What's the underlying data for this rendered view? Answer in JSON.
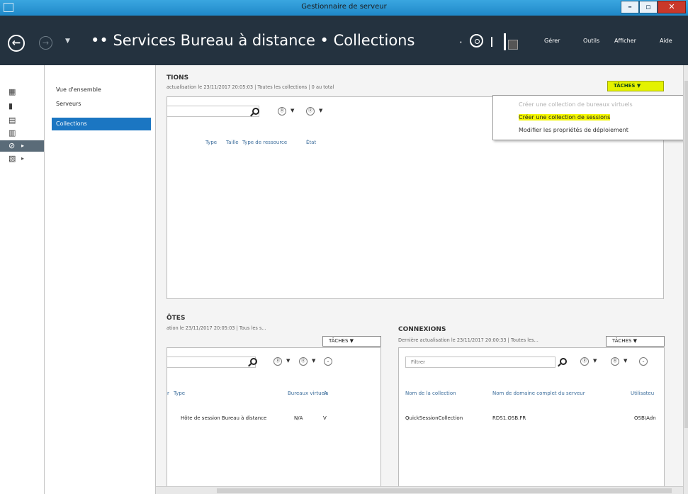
{
  "window": {
    "title": "Gestionnaire de serveur",
    "minimize": "–",
    "maximize": "▫",
    "close": "✕"
  },
  "header": {
    "back": "←",
    "forward": "→",
    "breadcrumb": "•• Services Bureau à distance • Collections",
    "menu": [
      "Gérer",
      "Outils",
      "Afficher",
      "Aide"
    ]
  },
  "nav": {
    "items": [
      "Vue d'ensemble",
      "Serveurs",
      "Collections"
    ],
    "selected_index": 2
  },
  "collections": {
    "title": "TIONS",
    "subtitle": "actualisation le 23/11/2017 20:05:03 | Toutes les collections | 0 au total",
    "tasks_label": "TÂCHES ▼",
    "columns": [
      "Type",
      "Taille",
      "Type de ressource",
      "État"
    ]
  },
  "tasks_menu": {
    "items": [
      {
        "label": "Créer une collection de bureaux virtuels",
        "state": "disabled"
      },
      {
        "label": "Créer une collection de sessions",
        "state": "highlighted"
      },
      {
        "label": "Modifier les propriétés de déploiement",
        "state": "normal"
      }
    ]
  },
  "hosts": {
    "title": "ÔTES",
    "subtitle": "ation le 23/11/2017 20:05:03 | Tous les s...",
    "tasks_label": "TÂCHES ▼",
    "columns": [
      "r",
      "Type",
      "Bureaux virtuels",
      "A"
    ],
    "rows": [
      {
        "type": "Hôte de session Bureau à distance",
        "virtual": "N/A",
        "extra": "V"
      }
    ]
  },
  "connections": {
    "title": "CONNEXIONS",
    "subtitle": "Dernière actualisation le 23/11/2017 20:00:33 | Toutes les...",
    "tasks_label": "TÂCHES ▼",
    "filter_placeholder": "Filtrer",
    "columns": [
      "Nom de la collection",
      "Nom de domaine complet du serveur",
      "Utilisateu"
    ],
    "rows": [
      {
        "collection": "QuickSessionCollection",
        "server": "RDS1.OSB.FR",
        "user": "OSB\\Adn"
      }
    ]
  },
  "glyphs": {
    "caret": "▼",
    "circle_a": "Ⓡ",
    "circle_b": "Ⓡ",
    "expand": "⌄",
    "arrow": "▸"
  },
  "colors": {
    "titlebar": "#2a9ad6",
    "header": "#24323f",
    "nav_selected": "#1b76c2",
    "highlight": "#e4f200",
    "close": "#c9382a"
  }
}
